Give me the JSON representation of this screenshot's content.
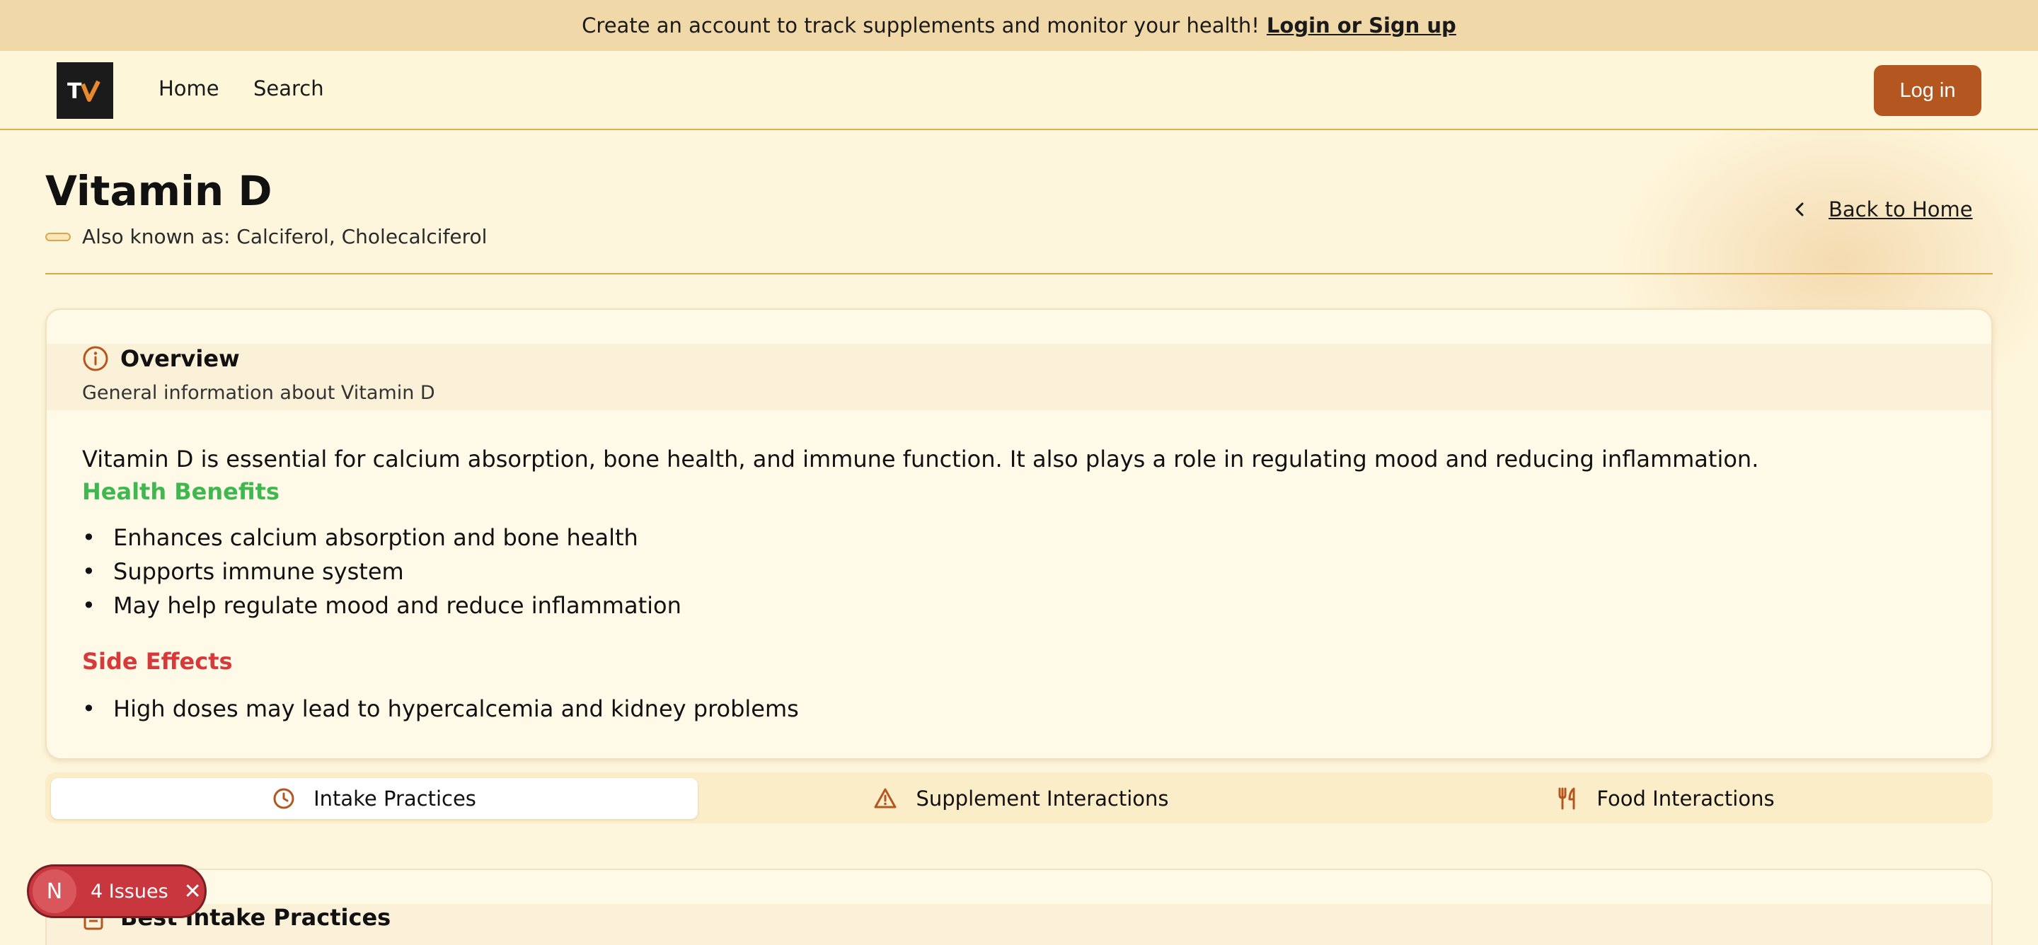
{
  "banner": {
    "text": "Create an account to track supplements and monitor your health!",
    "link": "Login or Sign up"
  },
  "nav": {
    "logo_text": "TV",
    "items": [
      "Home",
      "Search"
    ],
    "login_label": "Log in"
  },
  "supplement": {
    "name": "Vitamin D",
    "aka": "Also known as: Calciferol, Cholecalciferol",
    "back_label": "Back to Home"
  },
  "overview": {
    "title": "Overview",
    "subtitle": "General information about Vitamin D",
    "description": "Vitamin D is essential for calcium absorption, bone health, and immune function. It also plays a role in regulating mood and reducing inflammation.",
    "benefits_title": "Health Benefits",
    "benefits": [
      "Enhances calcium absorption and bone health",
      "Supports immune system",
      "May help regulate mood and reduce inflammation"
    ],
    "side_effects_title": "Side Effects",
    "side_effects": [
      "High doses may lead to hypercalcemia and kidney problems"
    ]
  },
  "tabs": [
    {
      "label": "Intake Practices",
      "icon": "clock-icon",
      "active": true
    },
    {
      "label": "Supplement Interactions",
      "icon": "warning-icon",
      "active": false
    },
    {
      "label": "Food Interactions",
      "icon": "utensils-icon",
      "active": false
    }
  ],
  "intake": {
    "title": "Best Intake Practices"
  },
  "dev_badge": {
    "letter": "N",
    "label": "4 Issues"
  },
  "colors": {
    "accent": "#b45620",
    "banner_bg": "#f0d8a8",
    "page_bg": "#fef6dc",
    "benefits": "#3fb94f",
    "side_effects": "#d63a3a"
  }
}
